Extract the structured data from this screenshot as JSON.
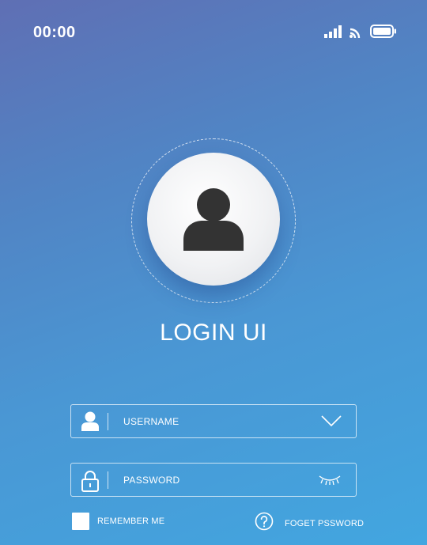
{
  "status_bar": {
    "time": "00:00",
    "icons": [
      "cellular-signal-icon",
      "wifi-icon",
      "battery-icon"
    ]
  },
  "avatar": {
    "icon": "user-icon"
  },
  "title": "LOGIN UI",
  "form": {
    "username": {
      "placeholder": "USERNAME",
      "value": "",
      "icon": "user-icon",
      "trailing_icon": "chevron-down-icon"
    },
    "password": {
      "placeholder": "PASSWORD",
      "value": "",
      "icon": "lock-icon",
      "trailing_icon": "eye-closed-icon"
    }
  },
  "remember_me": {
    "label": "REMEMBER ME",
    "checked": false
  },
  "forgot_password": {
    "label": "FOGET PSSWORD",
    "icon": "help-circle-icon"
  },
  "colors": {
    "gradient_top": "#5f6fb4",
    "gradient_bottom": "#42a6e0",
    "avatar_icon": "#333333",
    "text": "#ffffff"
  }
}
